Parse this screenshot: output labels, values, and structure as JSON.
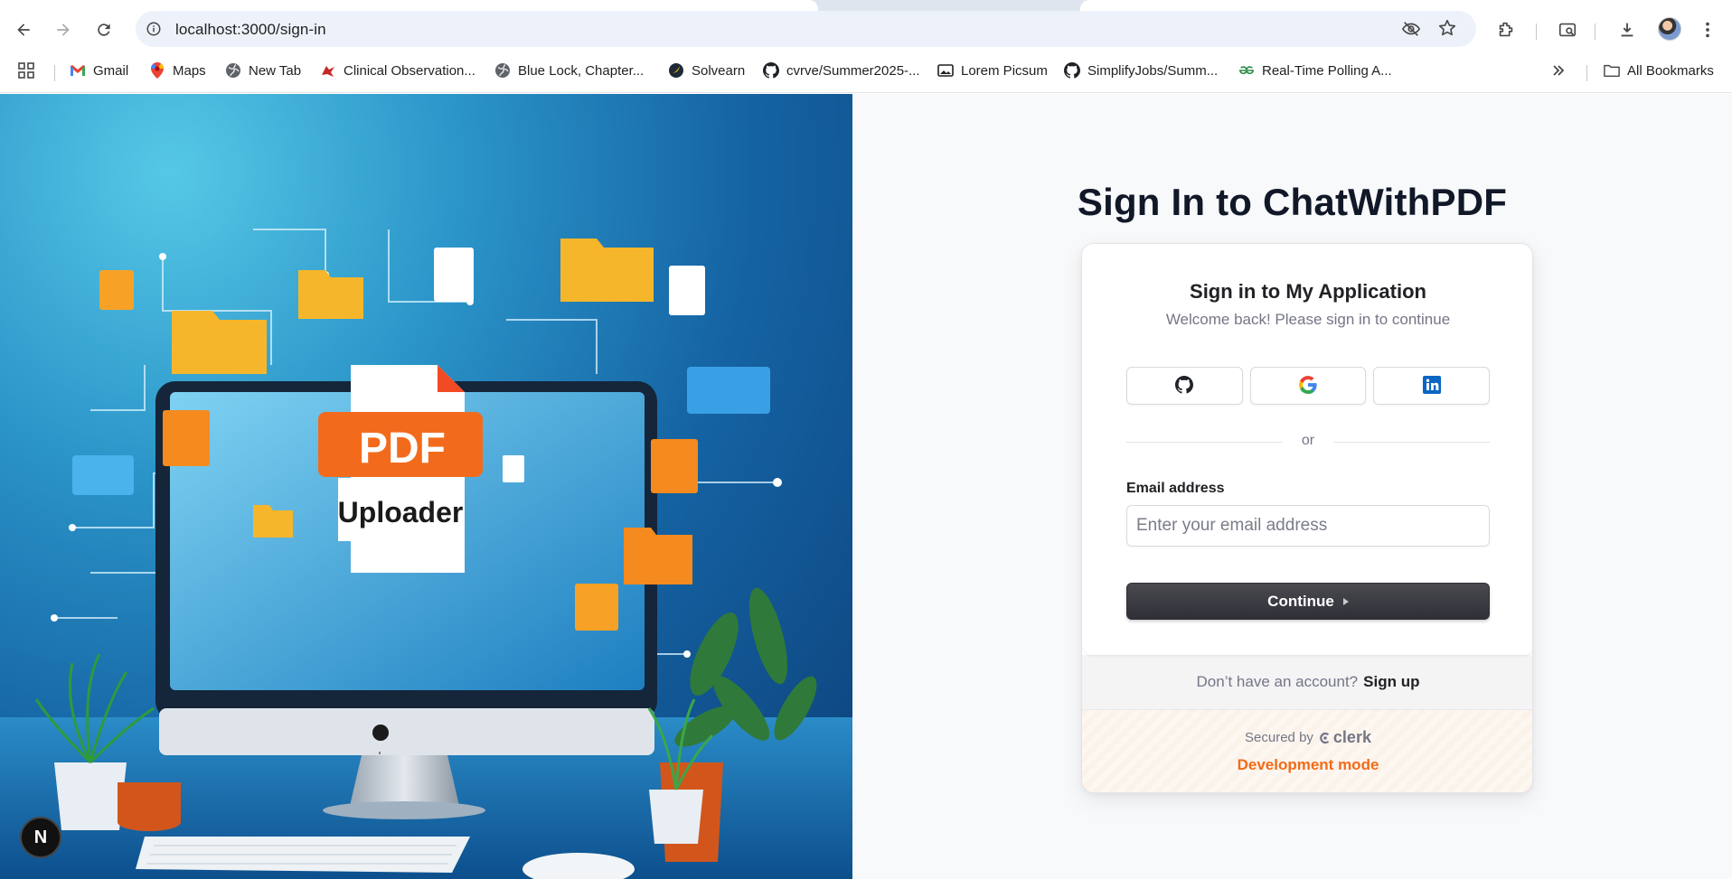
{
  "browser": {
    "url": "localhost:3000/sign-in",
    "bookmarks": [
      {
        "label": "Gmail",
        "icon": "gmail-icon"
      },
      {
        "label": "Maps",
        "icon": "maps-icon"
      },
      {
        "label": "New Tab",
        "icon": "globe-icon"
      },
      {
        "label": "Clinical Observation...",
        "icon": "bird-icon"
      },
      {
        "label": "Blue Lock, Chapter...",
        "icon": "globe-icon"
      },
      {
        "label": "Solvearn",
        "icon": "solvearn-icon"
      },
      {
        "label": "cvrve/Summer2025-...",
        "icon": "github-icon"
      },
      {
        "label": "Lorem Picsum",
        "icon": "image-icon"
      },
      {
        "label": "SimplifyJobs/Summ...",
        "icon": "github-icon"
      },
      {
        "label": "Real-Time Polling A...",
        "icon": "gfg-icon"
      }
    ],
    "all_bookmarks": "All Bookmarks"
  },
  "hero": {
    "badge_line1": "PDF",
    "badge_line2": "Uploader"
  },
  "page": {
    "title": "Sign In to ChatWithPDF"
  },
  "card": {
    "title": "Sign in to My Application",
    "subtitle": "Welcome back! Please sign in to continue",
    "social": [
      "GitHub",
      "Google",
      "LinkedIn"
    ],
    "divider": "or",
    "email_label": "Email address",
    "email_placeholder": "Enter your email address",
    "email_value": "",
    "continue": "Continue",
    "no_account": "Don’t have an account?",
    "sign_up": "Sign up",
    "secured_by": "Secured by",
    "clerk": "clerk",
    "dev_mode": "Development mode"
  },
  "next_badge": "N",
  "colors": {
    "accent_orange": "#f36b16",
    "button_dark": "#2f3037",
    "hero_blue": "#1563a3"
  }
}
